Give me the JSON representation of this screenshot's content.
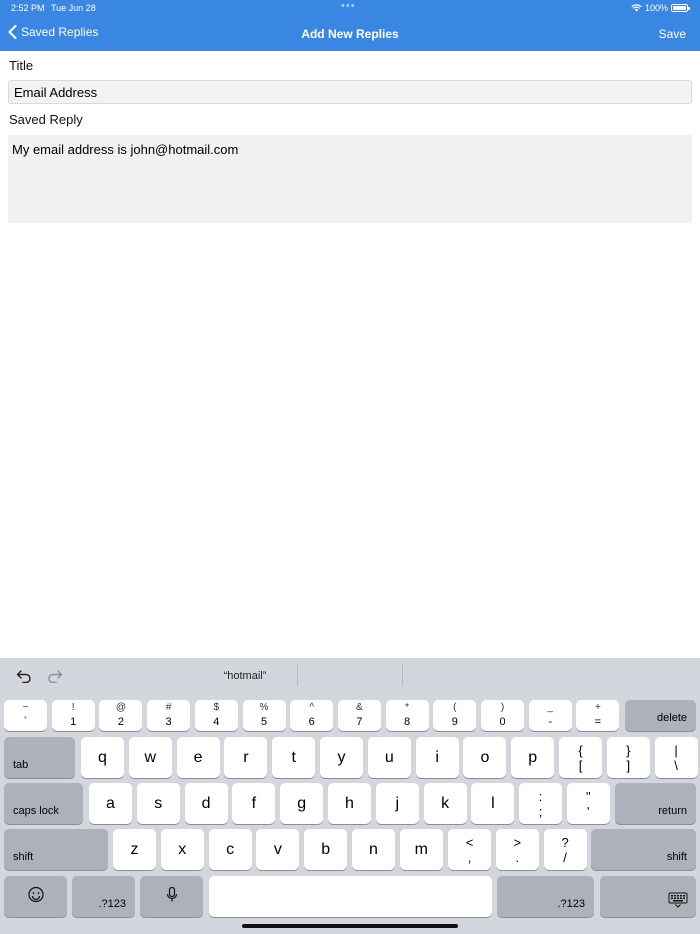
{
  "status_bar": {
    "time": "2:52 PM",
    "date": "Tue Jun 28",
    "battery": "100%",
    "battery_level": 1.0
  },
  "nav": {
    "back_label": "Saved Replies",
    "title": "Add New Replies",
    "save_label": "Save"
  },
  "form": {
    "title_label": "Title",
    "title_value": "Email Address",
    "reply_label": "Saved Reply",
    "reply_value": "My email address is john@hotmail.com"
  },
  "keyboard": {
    "suggestion": "“hotmail”",
    "row1": [
      {
        "top": "~",
        "bottom": "`"
      },
      {
        "top": "!",
        "bottom": "1"
      },
      {
        "top": "@",
        "bottom": "2"
      },
      {
        "top": "#",
        "bottom": "3"
      },
      {
        "top": "$",
        "bottom": "4"
      },
      {
        "top": "%",
        "bottom": "5"
      },
      {
        "top": "^",
        "bottom": "6"
      },
      {
        "top": "&",
        "bottom": "7"
      },
      {
        "top": "*",
        "bottom": "8"
      },
      {
        "top": "(",
        "bottom": "9"
      },
      {
        "top": ")",
        "bottom": "0"
      },
      {
        "top": "_",
        "bottom": "-"
      },
      {
        "top": "+",
        "bottom": "="
      }
    ],
    "delete": "delete",
    "tab": "tab",
    "row2": [
      "q",
      "w",
      "e",
      "r",
      "t",
      "y",
      "u",
      "i",
      "o",
      "p"
    ],
    "row2_sym": [
      {
        "top": "{",
        "bottom": "["
      },
      {
        "top": "}",
        "bottom": "]"
      },
      {
        "top": "|",
        "bottom": "\\"
      }
    ],
    "caps": "caps lock",
    "row3": [
      "a",
      "s",
      "d",
      "f",
      "g",
      "h",
      "j",
      "k",
      "l"
    ],
    "row3_sym": [
      {
        "top": ":",
        "bottom": ";"
      },
      {
        "top": "\"",
        "bottom": "'"
      }
    ],
    "return": "return",
    "shift": "shift",
    "row4": [
      "z",
      "x",
      "c",
      "v",
      "b",
      "n",
      "m"
    ],
    "row4_sym": [
      {
        "top": "<",
        "bottom": ","
      },
      {
        "top": ">",
        "bottom": "."
      },
      {
        "top": "?",
        "bottom": "/"
      }
    ],
    "num_label": ".?123"
  },
  "icons": [
    "chevron-left-icon",
    "wifi-icon",
    "battery-icon",
    "undo-icon",
    "redo-icon",
    "emoji-icon",
    "microphone-icon",
    "keyboard-dismiss-icon"
  ]
}
